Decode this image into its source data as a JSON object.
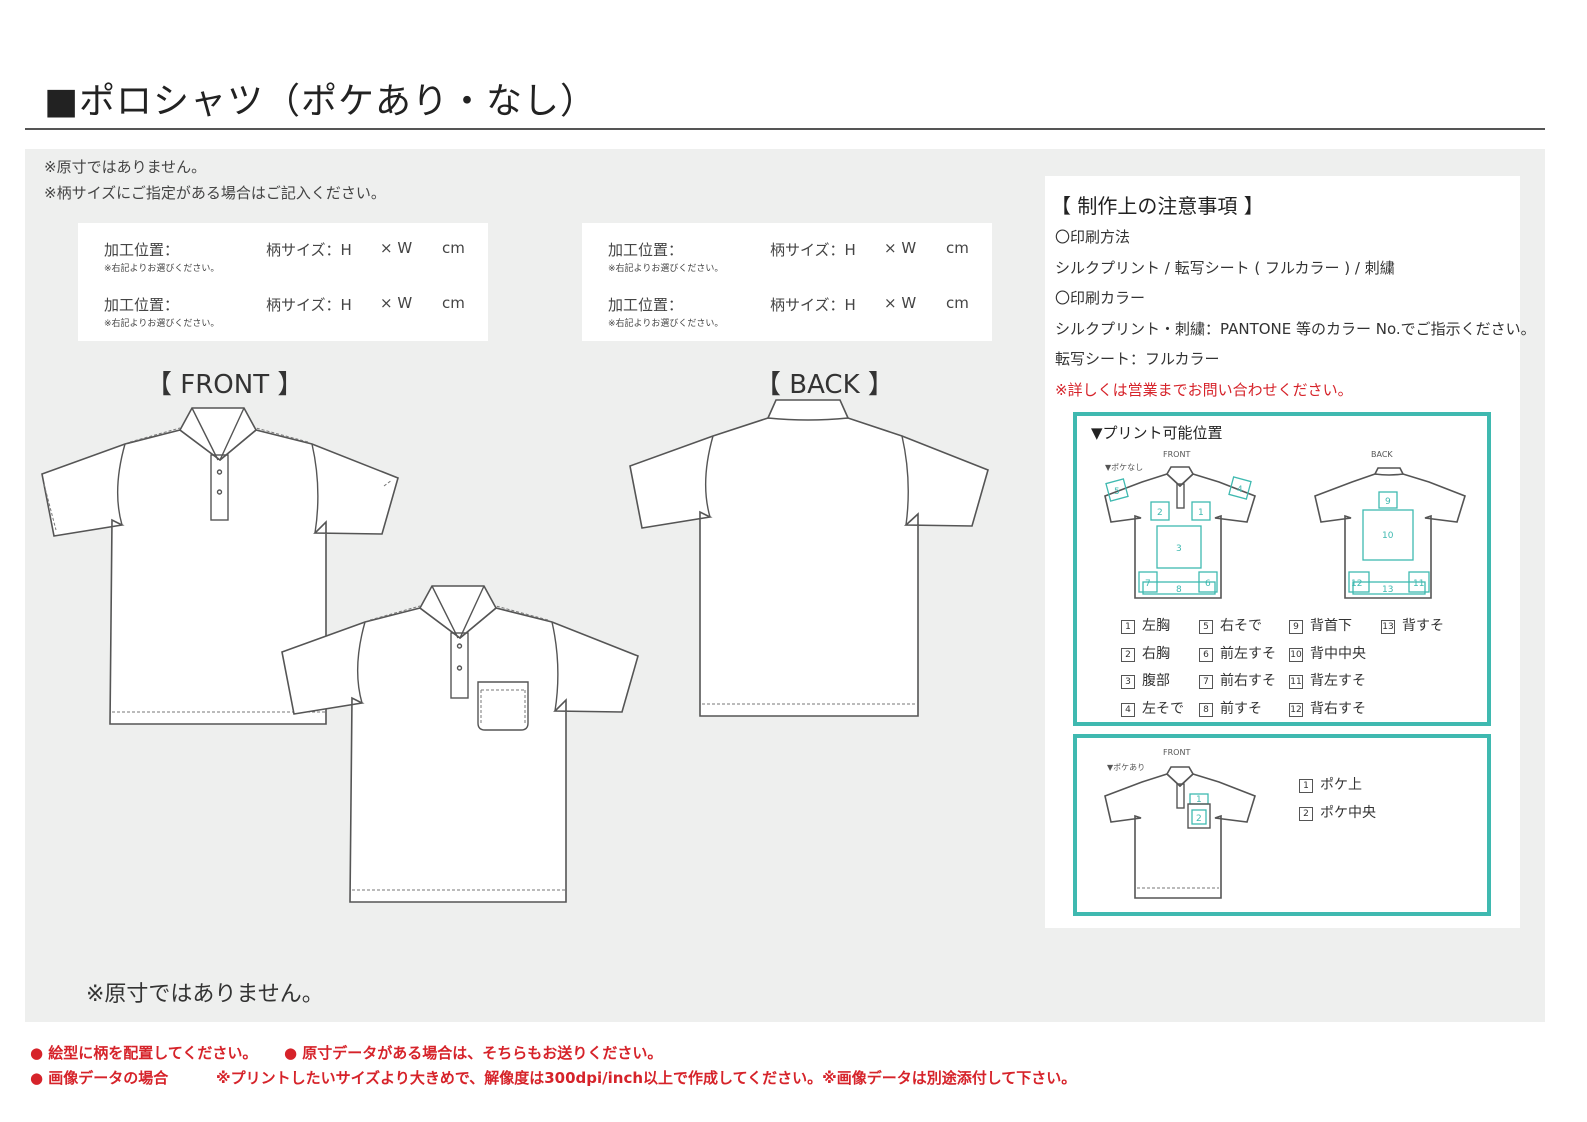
{
  "title": "■ポロシャツ（ポケあり・なし）",
  "notes_top": [
    "※原寸ではありません。",
    "※柄サイズにご指定がある場合はご記入ください。"
  ],
  "spec": {
    "position_label": "加工位置：",
    "position_sub": "※右記よりお選びください。",
    "size_label": "柄サイズ：H",
    "times": "× W",
    "unit": "cm"
  },
  "views": {
    "front": "【 FRONT 】",
    "back": "【 BACK 】"
  },
  "production_notes": {
    "heading": "【 制作上の注意事項 】",
    "method_heading": "〇印刷方法",
    "method_text": "シルクプリント / 転写シート ( フルカラー ) / 刺繍",
    "color_heading": "〇印刷カラー",
    "color_text_1": "シルクプリント・刺繍：PANTONE 等のカラー No.でご指示ください。",
    "color_text_2": "転写シート：フルカラー",
    "contact": "※詳しくは営業までお問い合わせください。"
  },
  "print_positions": {
    "title": "▼プリント可能位置",
    "front_label": "FRONT",
    "back_label": "BACK",
    "no_pocket_label": "▼ポケなし",
    "items": [
      {
        "num": "1",
        "label": "左胸"
      },
      {
        "num": "2",
        "label": "右胸"
      },
      {
        "num": "3",
        "label": "腹部"
      },
      {
        "num": "4",
        "label": "左そで"
      },
      {
        "num": "5",
        "label": "右そで"
      },
      {
        "num": "6",
        "label": "前左すそ"
      },
      {
        "num": "7",
        "label": "前右すそ"
      },
      {
        "num": "8",
        "label": "前すそ"
      },
      {
        "num": "9",
        "label": "背首下"
      },
      {
        "num": "10",
        "label": "背中中央"
      },
      {
        "num": "11",
        "label": "背左すそ"
      },
      {
        "num": "12",
        "label": "背右すそ"
      },
      {
        "num": "13",
        "label": "背すそ"
      }
    ]
  },
  "pocket_positions": {
    "front_label": "FRONT",
    "with_pocket_label": "▼ポケあり",
    "items": [
      {
        "num": "1",
        "label": "ポケ上"
      },
      {
        "num": "2",
        "label": "ポケ中央"
      }
    ]
  },
  "bottom_note": "※原寸ではありません。",
  "footer": {
    "line1_a": "● 絵型に柄を配置してください。",
    "line1_b": "● 原寸データがある場合は、そちらもお送りください。",
    "line2_a": "● 画像データの場合",
    "line2_b": "※プリントしたいサイズより大きめで、解像度は300dpi/inch以上で作成してください。※画像データは別途添付して下さい。"
  },
  "colors": {
    "accent_teal": "#3fb9b0",
    "warning_red": "#d6232a",
    "panel_gray": "#eeefee"
  }
}
